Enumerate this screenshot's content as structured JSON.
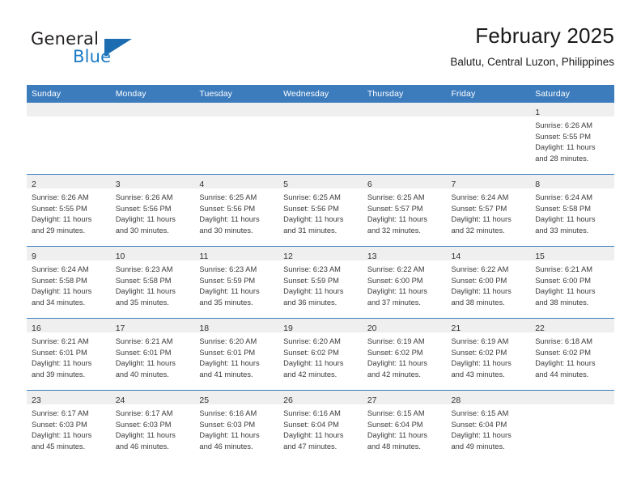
{
  "brand": {
    "name_part1": "General",
    "name_part2": "Blue",
    "flag_icon": "blue-flag-triangle",
    "accent_color": "#1b7ac4"
  },
  "header": {
    "title": "February 2025",
    "subtitle": "Balutu, Central Luzon, Philippines"
  },
  "theme": {
    "header_row_bg": "#3c7cbd",
    "daynum_band_bg": "#efefef",
    "cell_bg": "#ffffff",
    "text_color": "#3b3b3b"
  },
  "weekdays": [
    "Sunday",
    "Monday",
    "Tuesday",
    "Wednesday",
    "Thursday",
    "Friday",
    "Saturday"
  ],
  "weeks": [
    [
      {
        "day": "",
        "lines": []
      },
      {
        "day": "",
        "lines": []
      },
      {
        "day": "",
        "lines": []
      },
      {
        "day": "",
        "lines": []
      },
      {
        "day": "",
        "lines": []
      },
      {
        "day": "",
        "lines": []
      },
      {
        "day": "1",
        "lines": [
          "Sunrise: 6:26 AM",
          "Sunset: 5:55 PM",
          "Daylight: 11 hours",
          "and 28 minutes."
        ]
      }
    ],
    [
      {
        "day": "2",
        "lines": [
          "Sunrise: 6:26 AM",
          "Sunset: 5:55 PM",
          "Daylight: 11 hours",
          "and 29 minutes."
        ]
      },
      {
        "day": "3",
        "lines": [
          "Sunrise: 6:26 AM",
          "Sunset: 5:56 PM",
          "Daylight: 11 hours",
          "and 30 minutes."
        ]
      },
      {
        "day": "4",
        "lines": [
          "Sunrise: 6:25 AM",
          "Sunset: 5:56 PM",
          "Daylight: 11 hours",
          "and 30 minutes."
        ]
      },
      {
        "day": "5",
        "lines": [
          "Sunrise: 6:25 AM",
          "Sunset: 5:56 PM",
          "Daylight: 11 hours",
          "and 31 minutes."
        ]
      },
      {
        "day": "6",
        "lines": [
          "Sunrise: 6:25 AM",
          "Sunset: 5:57 PM",
          "Daylight: 11 hours",
          "and 32 minutes."
        ]
      },
      {
        "day": "7",
        "lines": [
          "Sunrise: 6:24 AM",
          "Sunset: 5:57 PM",
          "Daylight: 11 hours",
          "and 32 minutes."
        ]
      },
      {
        "day": "8",
        "lines": [
          "Sunrise: 6:24 AM",
          "Sunset: 5:58 PM",
          "Daylight: 11 hours",
          "and 33 minutes."
        ]
      }
    ],
    [
      {
        "day": "9",
        "lines": [
          "Sunrise: 6:24 AM",
          "Sunset: 5:58 PM",
          "Daylight: 11 hours",
          "and 34 minutes."
        ]
      },
      {
        "day": "10",
        "lines": [
          "Sunrise: 6:23 AM",
          "Sunset: 5:58 PM",
          "Daylight: 11 hours",
          "and 35 minutes."
        ]
      },
      {
        "day": "11",
        "lines": [
          "Sunrise: 6:23 AM",
          "Sunset: 5:59 PM",
          "Daylight: 11 hours",
          "and 35 minutes."
        ]
      },
      {
        "day": "12",
        "lines": [
          "Sunrise: 6:23 AM",
          "Sunset: 5:59 PM",
          "Daylight: 11 hours",
          "and 36 minutes."
        ]
      },
      {
        "day": "13",
        "lines": [
          "Sunrise: 6:22 AM",
          "Sunset: 6:00 PM",
          "Daylight: 11 hours",
          "and 37 minutes."
        ]
      },
      {
        "day": "14",
        "lines": [
          "Sunrise: 6:22 AM",
          "Sunset: 6:00 PM",
          "Daylight: 11 hours",
          "and 38 minutes."
        ]
      },
      {
        "day": "15",
        "lines": [
          "Sunrise: 6:21 AM",
          "Sunset: 6:00 PM",
          "Daylight: 11 hours",
          "and 38 minutes."
        ]
      }
    ],
    [
      {
        "day": "16",
        "lines": [
          "Sunrise: 6:21 AM",
          "Sunset: 6:01 PM",
          "Daylight: 11 hours",
          "and 39 minutes."
        ]
      },
      {
        "day": "17",
        "lines": [
          "Sunrise: 6:21 AM",
          "Sunset: 6:01 PM",
          "Daylight: 11 hours",
          "and 40 minutes."
        ]
      },
      {
        "day": "18",
        "lines": [
          "Sunrise: 6:20 AM",
          "Sunset: 6:01 PM",
          "Daylight: 11 hours",
          "and 41 minutes."
        ]
      },
      {
        "day": "19",
        "lines": [
          "Sunrise: 6:20 AM",
          "Sunset: 6:02 PM",
          "Daylight: 11 hours",
          "and 42 minutes."
        ]
      },
      {
        "day": "20",
        "lines": [
          "Sunrise: 6:19 AM",
          "Sunset: 6:02 PM",
          "Daylight: 11 hours",
          "and 42 minutes."
        ]
      },
      {
        "day": "21",
        "lines": [
          "Sunrise: 6:19 AM",
          "Sunset: 6:02 PM",
          "Daylight: 11 hours",
          "and 43 minutes."
        ]
      },
      {
        "day": "22",
        "lines": [
          "Sunrise: 6:18 AM",
          "Sunset: 6:02 PM",
          "Daylight: 11 hours",
          "and 44 minutes."
        ]
      }
    ],
    [
      {
        "day": "23",
        "lines": [
          "Sunrise: 6:17 AM",
          "Sunset: 6:03 PM",
          "Daylight: 11 hours",
          "and 45 minutes."
        ]
      },
      {
        "day": "24",
        "lines": [
          "Sunrise: 6:17 AM",
          "Sunset: 6:03 PM",
          "Daylight: 11 hours",
          "and 46 minutes."
        ]
      },
      {
        "day": "25",
        "lines": [
          "Sunrise: 6:16 AM",
          "Sunset: 6:03 PM",
          "Daylight: 11 hours",
          "and 46 minutes."
        ]
      },
      {
        "day": "26",
        "lines": [
          "Sunrise: 6:16 AM",
          "Sunset: 6:04 PM",
          "Daylight: 11 hours",
          "and 47 minutes."
        ]
      },
      {
        "day": "27",
        "lines": [
          "Sunrise: 6:15 AM",
          "Sunset: 6:04 PM",
          "Daylight: 11 hours",
          "and 48 minutes."
        ]
      },
      {
        "day": "28",
        "lines": [
          "Sunrise: 6:15 AM",
          "Sunset: 6:04 PM",
          "Daylight: 11 hours",
          "and 49 minutes."
        ]
      },
      {
        "day": "",
        "lines": []
      }
    ]
  ]
}
